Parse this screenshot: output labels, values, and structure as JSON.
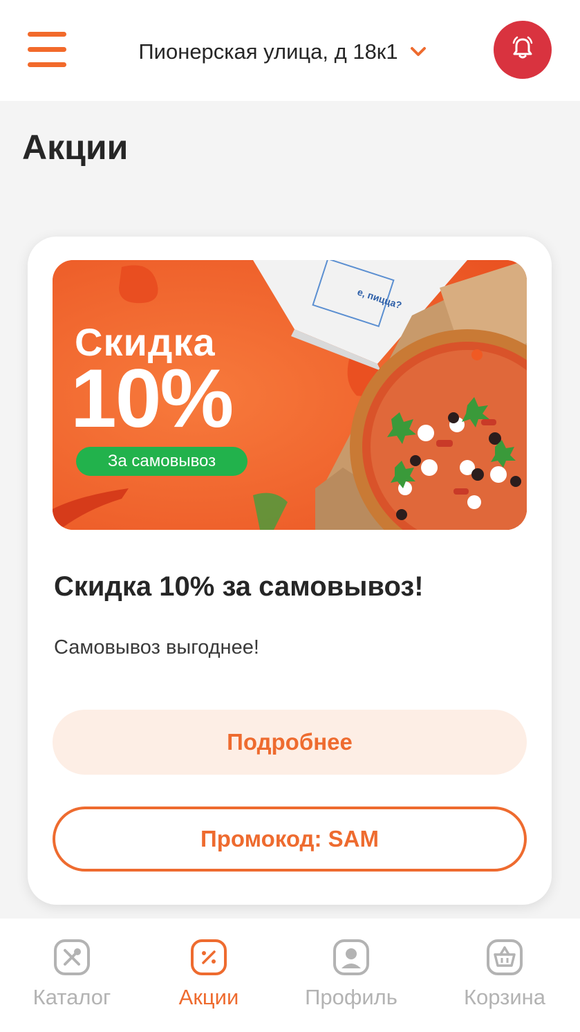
{
  "header": {
    "address": "Пионерская улица, д 18к1",
    "menu_icon": "hamburger-menu-icon",
    "address_icon": "chevron-down-icon",
    "notification_icon": "bell-icon"
  },
  "page": {
    "title": "Акции"
  },
  "promo": {
    "banner": {
      "headline": "Скидка",
      "percent": "10%",
      "pill": "За самовывоз",
      "box_text": "е, пицца?"
    },
    "title": "Скидка 10% за самовывоз!",
    "description": "Самовывоз выгоднее!",
    "details_button": "Подробнее",
    "promo_button": "Промокод: SAM"
  },
  "bottom_nav": {
    "items": [
      {
        "label": "Каталог",
        "icon": "fork-knife-icon",
        "active": false
      },
      {
        "label": "Акции",
        "icon": "percent-tag-icon",
        "active": true
      },
      {
        "label": "Профиль",
        "icon": "user-icon",
        "active": false
      },
      {
        "label": "Корзина",
        "icon": "basket-icon",
        "active": false
      }
    ]
  },
  "colors": {
    "accent": "#ee6b2f",
    "bell_bg": "#d9333f",
    "pill_green": "#22b24c",
    "inactive": "#b3b3b3",
    "details_bg": "#fdeee5"
  }
}
